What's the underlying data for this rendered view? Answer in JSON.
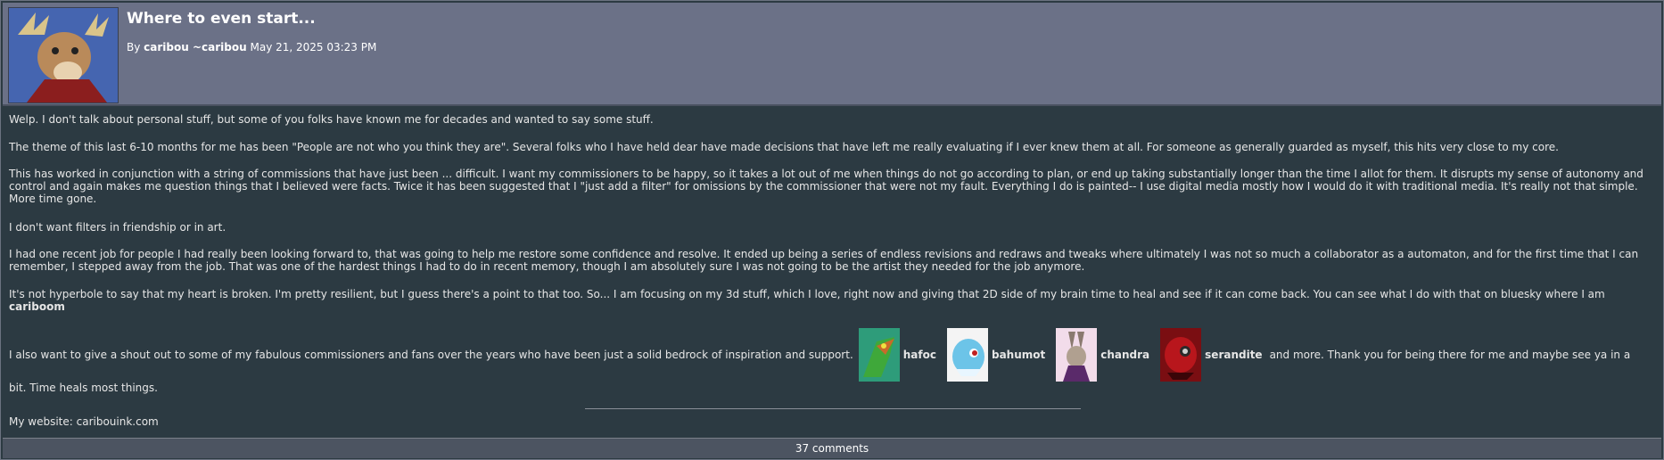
{
  "journal": {
    "title": "Where to even start...",
    "byline_prefix": "By",
    "author": "caribou ~caribou",
    "date": "May 21, 2025 03:23 PM"
  },
  "body": {
    "p1": "Welp. I don't talk about personal stuff, but some of you folks have known me for decades and wanted to say some stuff.",
    "p2": "The theme of this last 6-10 months for me has been \"People are not who you think they are\". Several folks who I have held dear have made decisions that have left me really evaluating if I ever knew them at all. For someone as generally guarded as myself, this hits very close to my core.",
    "p3": "This has worked in conjunction with a string of commissions that have just been ... difficult. I want my commissioners to be happy, so it takes a lot out of me when things do not go according to plan, or end up taking substantially longer than the time I allot for them. It disrupts my sense of autonomy and control and again makes me question things that I believed were facts. Twice it has been suggested that I \"just add a filter\" for omissions by the commissioner that were not my fault. Everything I do is painted-- I use digital media mostly how I would do it with traditional media. It's really not that simple. More time gone.",
    "p4": "I don't want filters in friendship or in art.",
    "p5": "I had one recent job for people I had really been looking forward to, that was going to help me restore some confidence and resolve. It ended up being a series of endless revisions and redraws and tweaks where ultimately I was not so much a collaborator as a automaton, and for the first time that I can remember, I stepped away from the job. That was one of the hardest things I had to do in recent memory, though I am absolutely sure I was not going to be the artist they needed for the job anymore.",
    "p6": "It's not hyperbole to say that my heart is broken. I'm pretty resilient, but I guess there's a point to that too. So... I am focusing on my 3d stuff, which I love, right now and giving that 2D side of my brain time to heal and see if it can come back. You can see what I do with that on bluesky where I am",
    "p6_handle": "cariboom",
    "p7_intro": "I also want to give a shout out to some of my fabulous commissioners and fans over the years who have been just a solid bedrock of inspiration and support.",
    "shoutouts": [
      "hafoc",
      "bahumot",
      "chandra",
      "serandite"
    ],
    "p7_outro": "and more. Thank you for being there for me and maybe see ya in a",
    "p8": "bit. Time heals most things.",
    "website": "My website: caribouink.com"
  },
  "footer": {
    "comments": "37 comments"
  }
}
